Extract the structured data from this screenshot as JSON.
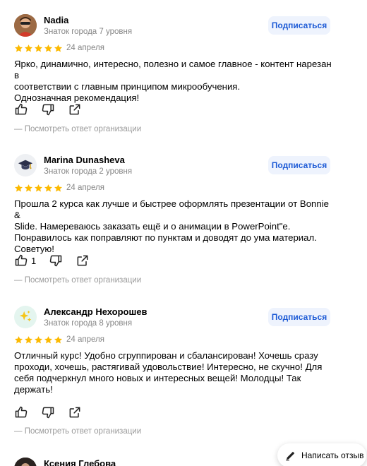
{
  "colors": {
    "star": "#fcb900",
    "subscribe_bg": "#eef3fd",
    "subscribe_text": "#1f5cd6",
    "muted": "#868686"
  },
  "reviews": [
    {
      "name": "Nadia",
      "level": "Знаток города 7 уровня",
      "subscribe_label": "Подписаться",
      "rating": 5,
      "date": "24 апреля",
      "text": [
        "Ярко, динамично, интересно, полезно и самое главное - контент нарезан в",
        "соответствии с главным принципом микрообучения.",
        "Однозначная рекомендация!"
      ],
      "likes": "",
      "reply_link": "— Посмотреть ответ организации",
      "avatar_icon": "photo-avatar"
    },
    {
      "name": "Marina Dunasheva",
      "level": "Знаток города 2 уровня",
      "subscribe_label": "Подписаться",
      "rating": 5,
      "date": "24 апреля",
      "text": [
        "Прошла 2 курса как лучше и быстрее оформлять презентации от Bonnie &",
        "Slide. Намереваюсь заказать ещё и о анимации в PowerPoint\"е.",
        "Понравилось как поправляют по пунктам и доводят до ума материал.",
        "Советую!"
      ],
      "likes": "1",
      "reply_link": "— Посмотреть ответ организации",
      "avatar_icon": "graduation-cap-icon"
    },
    {
      "name": "Александр Нехорошев",
      "level": "Знаток города 8 уровня",
      "subscribe_label": "Подписаться",
      "rating": 5,
      "date": "24 апреля",
      "text": [
        "Отличный курс! Удобно сгруппирован и сбалансирован! Хочешь сразу",
        "проходи, хочешь, растягивай удовольствие! Интересно, не скучно! Для",
        "себя подчеркнул много новых и интересных вещей! Молодцы! Так",
        "держать!"
      ],
      "likes": "",
      "reply_link": "— Посмотреть ответ организации",
      "avatar_icon": "sparkles-icon"
    },
    {
      "name": "Ксения Глебова",
      "avatar_icon": "photo-avatar"
    }
  ],
  "write_review_label": "Написать отзыв"
}
